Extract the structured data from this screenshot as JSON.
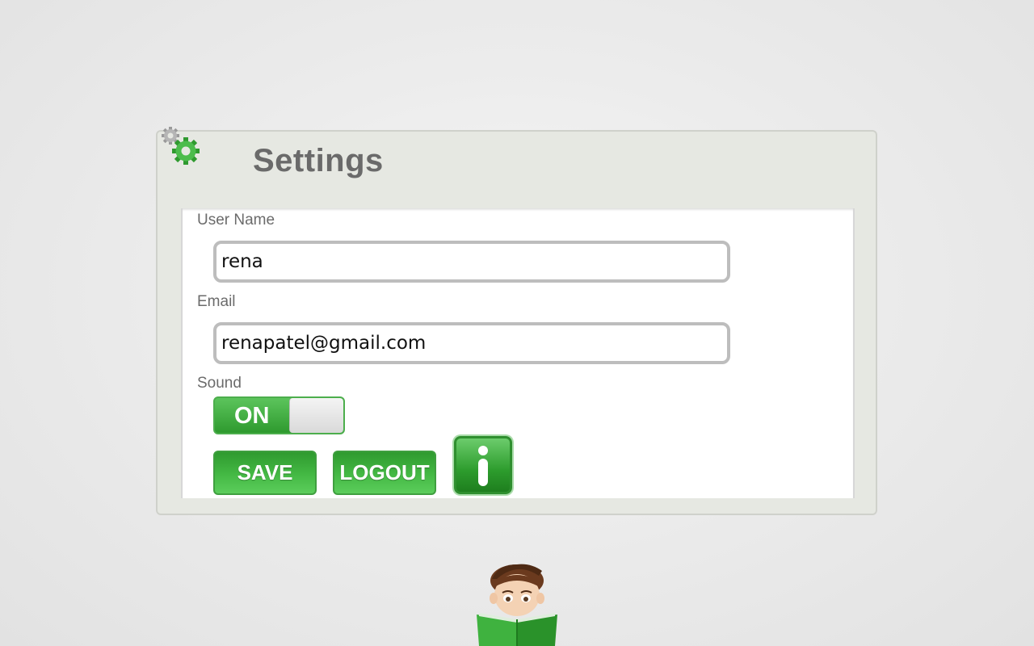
{
  "settings": {
    "title": "Settings",
    "username": {
      "label": "User Name",
      "value": "rena"
    },
    "email": {
      "label": "Email",
      "value": "renapatel@gmail.com"
    },
    "sound": {
      "label": "Sound",
      "state": "ON"
    },
    "buttons": {
      "save": "SAVE",
      "logout": "LOGOUT",
      "info_icon": "info-icon"
    }
  },
  "icons": {
    "header": "gears-icon",
    "mascot": "reading-boy-icon"
  },
  "colors": {
    "accent": "#3aaa3a",
    "panel": "#e6e8e2",
    "title": "#6a6a6a"
  }
}
